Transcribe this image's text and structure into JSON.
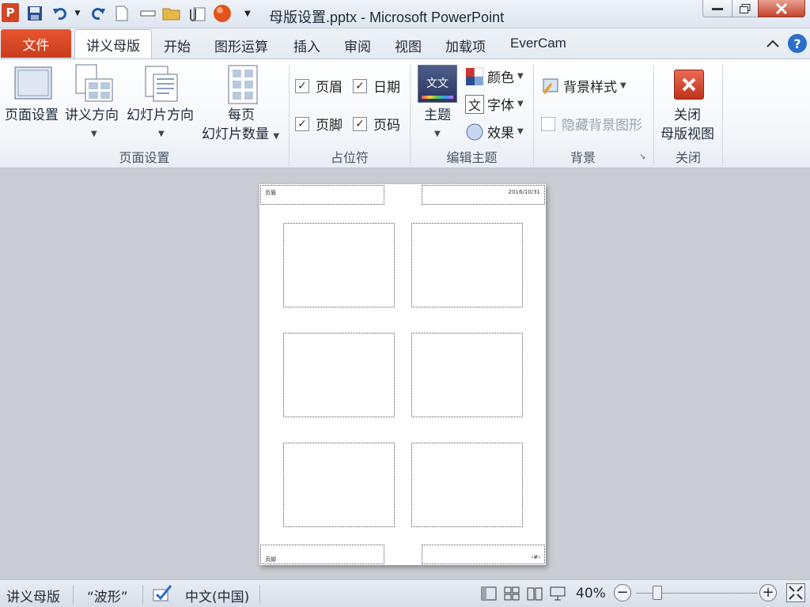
{
  "window": {
    "title": "母版设置.pptx - Microsoft PowerPoint",
    "app_icon_letter": "P"
  },
  "tabs": {
    "file": "文件",
    "items": [
      "讲义母版",
      "开始",
      "图形运算",
      "插入",
      "审阅",
      "视图",
      "加载项",
      "EverCam"
    ]
  },
  "ribbon": {
    "page_setup_group": {
      "page_setup": "页面设置",
      "handout_orientation": "讲义方向",
      "slide_orientation": "幻灯片方向",
      "slides_per_page_line1": "每页",
      "slides_per_page_line2": "幻灯片数量",
      "label": "页面设置"
    },
    "placeholders_group": {
      "header": "页眉",
      "date": "日期",
      "footer": "页脚",
      "page_number": "页码",
      "label": "占位符"
    },
    "edit_theme_group": {
      "theme": "主题",
      "theme_thumb_text": "文文",
      "colors": "颜色",
      "fonts": "字体",
      "fonts_glyph": "文",
      "effects": "效果",
      "label": "编辑主题"
    },
    "background_group": {
      "background_styles": "背景样式",
      "hide_background": "隐藏背景图形",
      "label": "背景"
    },
    "close_group": {
      "close_line1": "关闭",
      "close_line2": "母版视图",
      "label": "关闭"
    }
  },
  "handout": {
    "header_text": "页眉",
    "date_text": "2016/10/31",
    "footer_text": "页脚",
    "page_number_text": "‹#›"
  },
  "statusbar": {
    "view": "讲义母版",
    "theme": "“波形”",
    "language": "中文(中国)",
    "zoom": "40%"
  },
  "colors": {
    "file_tab": "#d9472a",
    "accent_blue": "#2a6fc9",
    "close_red": "#c6442d"
  }
}
